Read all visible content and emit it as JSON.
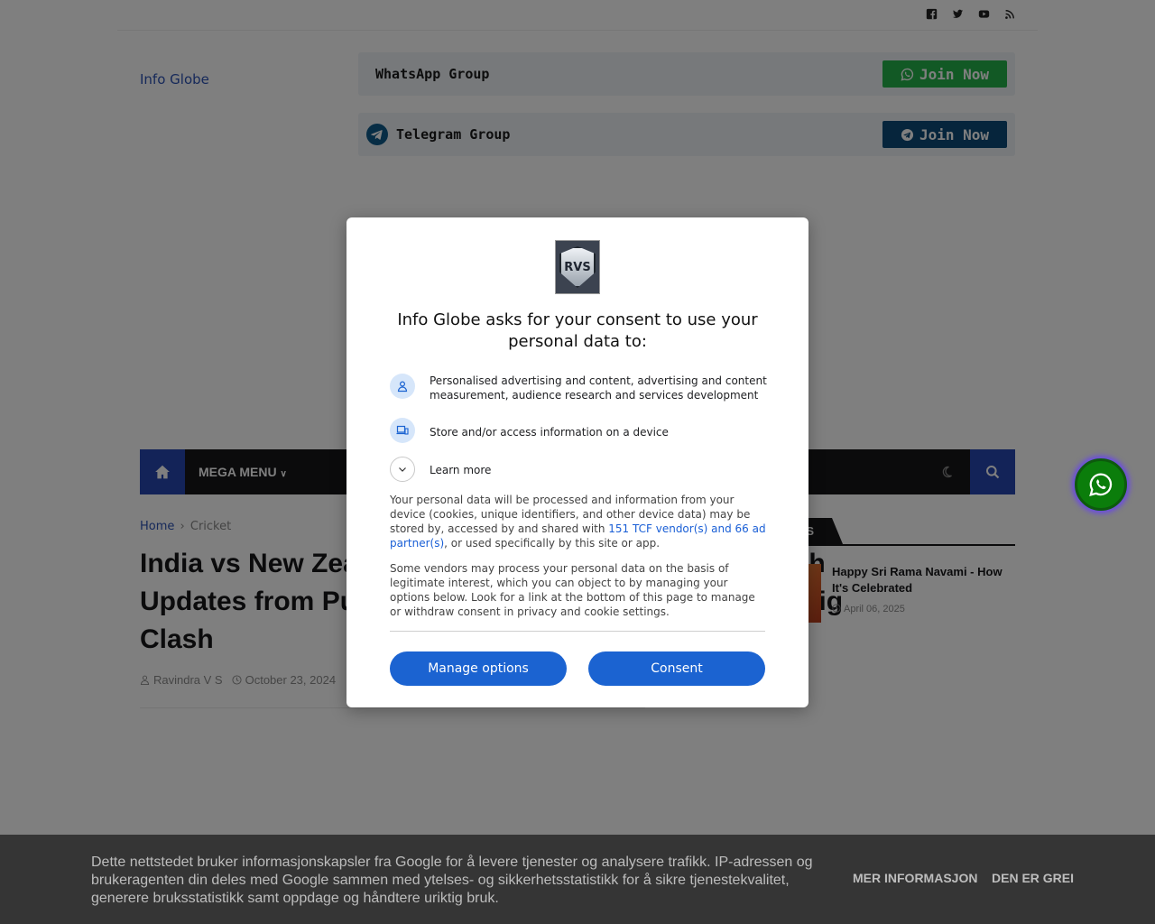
{
  "site": {
    "logo_text": "Info Globe"
  },
  "social_icons": [
    "facebook-icon",
    "twitter-icon",
    "youtube-icon",
    "rss-icon"
  ],
  "groups": {
    "whatsapp": {
      "title": "WhatsApp Group",
      "button": "Join Now",
      "color": "#25b34a"
    },
    "telegram": {
      "title": "Telegram Group",
      "button": "Join Now",
      "color": "#0d4a78"
    }
  },
  "nav": {
    "mega_menu": "MEGA MENU"
  },
  "breadcrumb": {
    "home": "Home",
    "separator": "›",
    "category": "Cricket"
  },
  "post": {
    "title": "India vs New Zealand 2nd Test: Live Score and Match Updates from Pune’s Maharashtra Cricket Stadium Big Clash",
    "author": "Ravindra V S",
    "date": "October 23, 2024"
  },
  "sidebar": {
    "heading": "POSTS",
    "item": {
      "title": "Happy Sri Rama Navami - How It's Celebrated",
      "date": "April 06, 2025"
    }
  },
  "consent": {
    "logo_text": "RVS",
    "title": "Info Globe asks for your consent to use your personal data to:",
    "purpose_1": "Personalised advertising and content, advertising and content measurement, audience research and services development",
    "purpose_2": "Store and/or access information on a device",
    "learn_more": "Learn more",
    "body_1_a": "Your personal data will be processed and information from your device (cookies, unique identifiers, and other device data) may be stored by, accessed by and shared with ",
    "body_1_link": "151 TCF vendor(s) and 66 ad partner(s)",
    "body_1_b": ", or used specifically by this site or app.",
    "body_2": "Some vendors may process your personal data on the basis of legitimate interest, which you can object to by managing your options below. Look for a link at the bottom of this page to manage or withdraw consent in privacy and cookie settings.",
    "manage_button": "Manage options",
    "consent_button": "Consent",
    "accent": "#1b63d1"
  },
  "cookie_bar": {
    "text": "Dette nettstedet bruker informasjonskapsler fra Google for å levere tjenester og analysere trafikk. IP-adressen og brukeragenten din deles med Google sammen med ytelses- og sikkerhetsstatistikk for å sikre tjenestekvalitet, generere bruksstatistikk samt oppdage og håndtere uriktig bruk.",
    "more_info": "MER INFORMASJON",
    "ok": "DEN ER GREI"
  }
}
